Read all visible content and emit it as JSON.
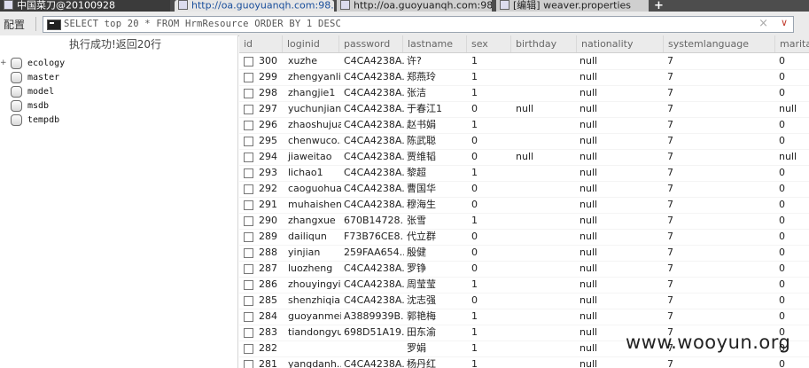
{
  "tabs": [
    {
      "title": "中国菜刀@20100928"
    },
    {
      "title": "http://oa.guoyuanqh.com:98..."
    },
    {
      "title": "http://oa.guoyuanqh.com:98..."
    },
    {
      "title": "[编辑] weaver.properties"
    }
  ],
  "new_tab_label": "+",
  "toolbar": {
    "config_label": "配置",
    "sql_query": "SELECT top 20 * FROM HrmResource ORDER BY 1 DESC",
    "clear_symbol": "×",
    "dropdown_symbol": "∨"
  },
  "status": "执行成功!返回20行",
  "tree": {
    "root": {
      "label": "ecology",
      "expander": "+"
    },
    "children": [
      {
        "label": "master"
      },
      {
        "label": "model"
      },
      {
        "label": "msdb"
      },
      {
        "label": "tempdb"
      }
    ]
  },
  "grid": {
    "columns": [
      "id",
      "loginid",
      "password",
      "lastname",
      "sex",
      "birthday",
      "nationality",
      "systemlanguage",
      "maritals"
    ],
    "rows": [
      [
        "300",
        "xuzhe",
        "C4CA4238A...",
        "许?",
        "1",
        "",
        "null",
        "7",
        "0"
      ],
      [
        "299",
        "zhengyanli...",
        "C4CA4238A...",
        "郑燕玲",
        "1",
        "",
        "null",
        "7",
        "0"
      ],
      [
        "298",
        "zhangjie1",
        "C4CA4238A...",
        "张洁",
        "1",
        "",
        "null",
        "7",
        "0"
      ],
      [
        "297",
        "yuchunjian...",
        "C4CA4238A...",
        "于春江1",
        "0",
        "null",
        "null",
        "7",
        "null"
      ],
      [
        "296",
        "zhaoshujuan",
        "C4CA4238A...",
        "赵书娟",
        "1",
        "",
        "null",
        "7",
        "0"
      ],
      [
        "295",
        "chenwuco...",
        "C4CA4238A...",
        "陈武聪",
        "0",
        "",
        "null",
        "7",
        "0"
      ],
      [
        "294",
        "jiaweitao",
        "C4CA4238A...",
        "贾维韬",
        "0",
        "null",
        "null",
        "7",
        "null"
      ],
      [
        "293",
        "lichao1",
        "C4CA4238A...",
        "黎超",
        "1",
        "",
        "null",
        "7",
        "0"
      ],
      [
        "292",
        "caoguohua",
        "C4CA4238A...",
        "曹国华",
        "0",
        "",
        "null",
        "7",
        "0"
      ],
      [
        "291",
        "muhaisheng",
        "C4CA4238A...",
        "穆海生",
        "0",
        "",
        "null",
        "7",
        "0"
      ],
      [
        "290",
        "zhangxue",
        "670B14728...",
        "张雪",
        "1",
        "",
        "null",
        "7",
        "0"
      ],
      [
        "289",
        "dailiqun",
        "F73B76CE8...",
        "代立群",
        "0",
        "",
        "null",
        "7",
        "0"
      ],
      [
        "288",
        "yinjian",
        "259FAA654...",
        "殷健",
        "0",
        "",
        "null",
        "7",
        "0"
      ],
      [
        "287",
        "luozheng",
        "C4CA4238A...",
        "罗铮",
        "0",
        "",
        "null",
        "7",
        "0"
      ],
      [
        "286",
        "zhouyingyi...",
        "C4CA4238A...",
        "周莹莹",
        "1",
        "",
        "null",
        "7",
        "0"
      ],
      [
        "285",
        "shenzhiqia...",
        "C4CA4238A...",
        "沈志强",
        "0",
        "",
        "null",
        "7",
        "0"
      ],
      [
        "284",
        "guoyanmei",
        "A3889939B...",
        "郭艳梅",
        "1",
        "",
        "null",
        "7",
        "0"
      ],
      [
        "283",
        "tiandongyu",
        "698D51A19...",
        "田东渝",
        "1",
        "",
        "null",
        "7",
        "0"
      ],
      [
        "282",
        "",
        "",
        "罗娟",
        "1",
        "",
        "null",
        "7",
        "0"
      ],
      [
        "281",
        "yangdanh...",
        "C4CA4238A...",
        "杨丹红",
        "1",
        "",
        "null",
        "7",
        "0"
      ]
    ]
  },
  "watermark": "www.wooyun.org"
}
